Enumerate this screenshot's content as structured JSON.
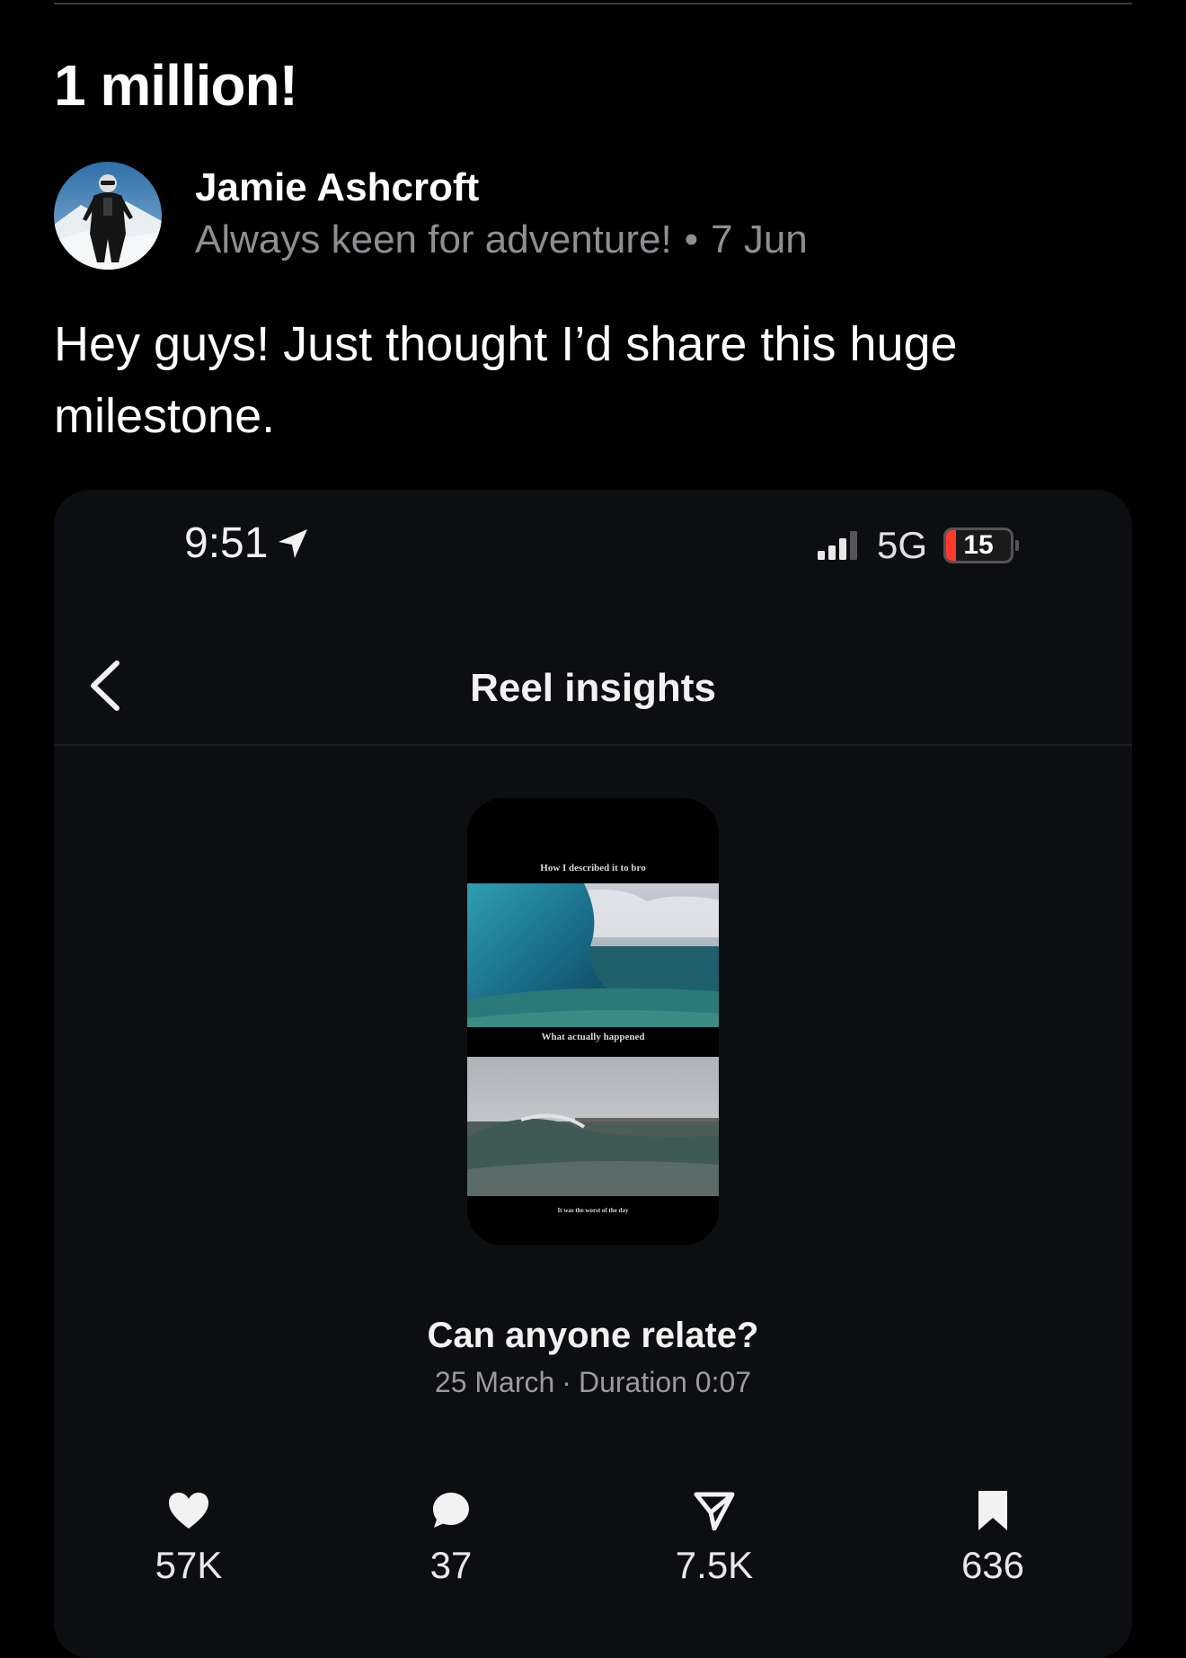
{
  "post": {
    "title": "1 million!",
    "author": {
      "name": "Jamie Ashcroft",
      "bio": "Always keen for adventure!",
      "separator": "•",
      "date": "7 Jun"
    },
    "body": "Hey guys! Just thought I’d share this huge milestone."
  },
  "screenshot": {
    "status_bar": {
      "time": "9:51",
      "network": "5G",
      "battery": "15",
      "battery_level_percent": 15,
      "battery_color": "#ff3b30"
    },
    "nav": {
      "title": "Reel insights"
    },
    "reel": {
      "caption_top": "How I described it to bro",
      "caption_middle": "What actually happened",
      "caption_bottom": "It was the worst of the day",
      "title": "Can anyone relate?",
      "date": "25 March",
      "separator": "·",
      "duration": "Duration 0:07"
    },
    "metrics": [
      {
        "icon": "heart-icon",
        "value": "57K"
      },
      {
        "icon": "comment-icon",
        "value": "37"
      },
      {
        "icon": "share-icon",
        "value": "7.5K"
      },
      {
        "icon": "bookmark-icon",
        "value": "636"
      }
    ]
  },
  "colors": {
    "background": "#000000",
    "card": "#0d0e11",
    "muted_text": "#8e8e93"
  }
}
